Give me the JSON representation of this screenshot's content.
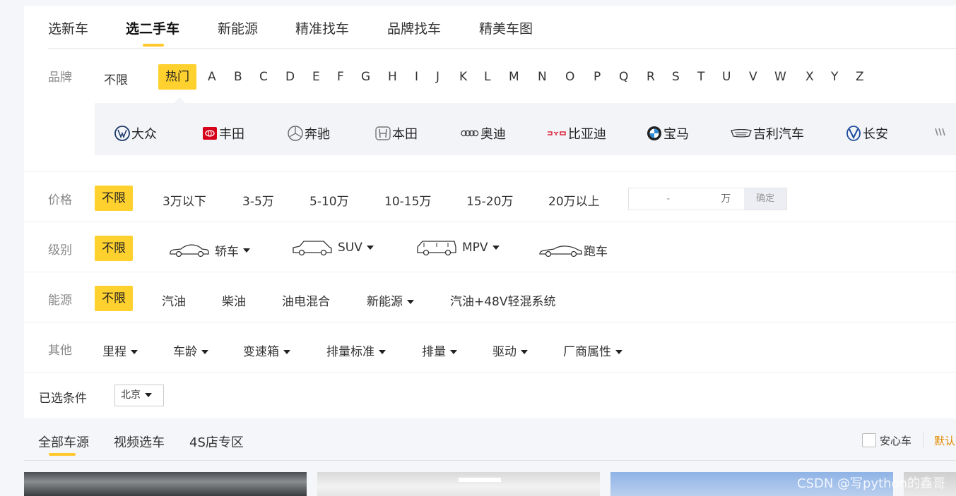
{
  "topnav": {
    "items": [
      "选新车",
      "选二手车",
      "新能源",
      "精准找车",
      "品牌找车",
      "精美车图"
    ],
    "active_index": 1
  },
  "brand_row": {
    "label": "品牌",
    "unlimited": "不限",
    "hot": "热门",
    "letters": [
      "A",
      "B",
      "C",
      "D",
      "E",
      "F",
      "G",
      "H",
      "I",
      "J",
      "K",
      "L",
      "M",
      "N",
      "O",
      "P",
      "Q",
      "R",
      "S",
      "T",
      "U",
      "V",
      "W",
      "X",
      "Y",
      "Z"
    ],
    "brands": [
      {
        "name": "大众",
        "icon": "volkswagen-logo-icon"
      },
      {
        "name": "丰田",
        "icon": "toyota-logo-icon"
      },
      {
        "name": "奔驰",
        "icon": "mercedes-logo-icon"
      },
      {
        "name": "本田",
        "icon": "honda-logo-icon"
      },
      {
        "name": "奥迪",
        "icon": "audi-logo-icon"
      },
      {
        "name": "比亚迪",
        "icon": "byd-logo-icon"
      },
      {
        "name": "宝马",
        "icon": "bmw-logo-icon"
      },
      {
        "name": "吉利汽车",
        "icon": "geely-logo-icon"
      },
      {
        "name": "长安",
        "icon": "changan-logo-icon"
      }
    ]
  },
  "price_row": {
    "label": "价格",
    "options": [
      "不限",
      "3万以下",
      "3-5万",
      "5-10万",
      "10-15万",
      "15-20万",
      "20万以上"
    ],
    "range_dash": "-",
    "range_unit": "万",
    "confirm": "确定"
  },
  "level_row": {
    "label": "级别",
    "unlimited": "不限",
    "options": [
      "轿车",
      "SUV",
      "MPV",
      "跑车"
    ]
  },
  "energy_row": {
    "label": "能源",
    "options": [
      "不限",
      "汽油",
      "柴油",
      "油电混合",
      "新能源",
      "汽油+48V轻混系统"
    ]
  },
  "other_row": {
    "label": "其他",
    "options": [
      "里程",
      "车龄",
      "变速箱",
      "排量标准",
      "排量",
      "驱动",
      "厂商属性"
    ]
  },
  "selected": {
    "label": "已选条件",
    "city": "北京"
  },
  "listing_tabs": {
    "tabs": [
      "全部车源",
      "视频选车",
      "4S店专区"
    ],
    "checkbox_label": "安心车",
    "sort_default": "默认排序"
  },
  "colors": {
    "accent_yellow": "#ffd12e",
    "sort_orange": "#e08a00"
  },
  "watermark": "CSDN @写python的鑫哥"
}
